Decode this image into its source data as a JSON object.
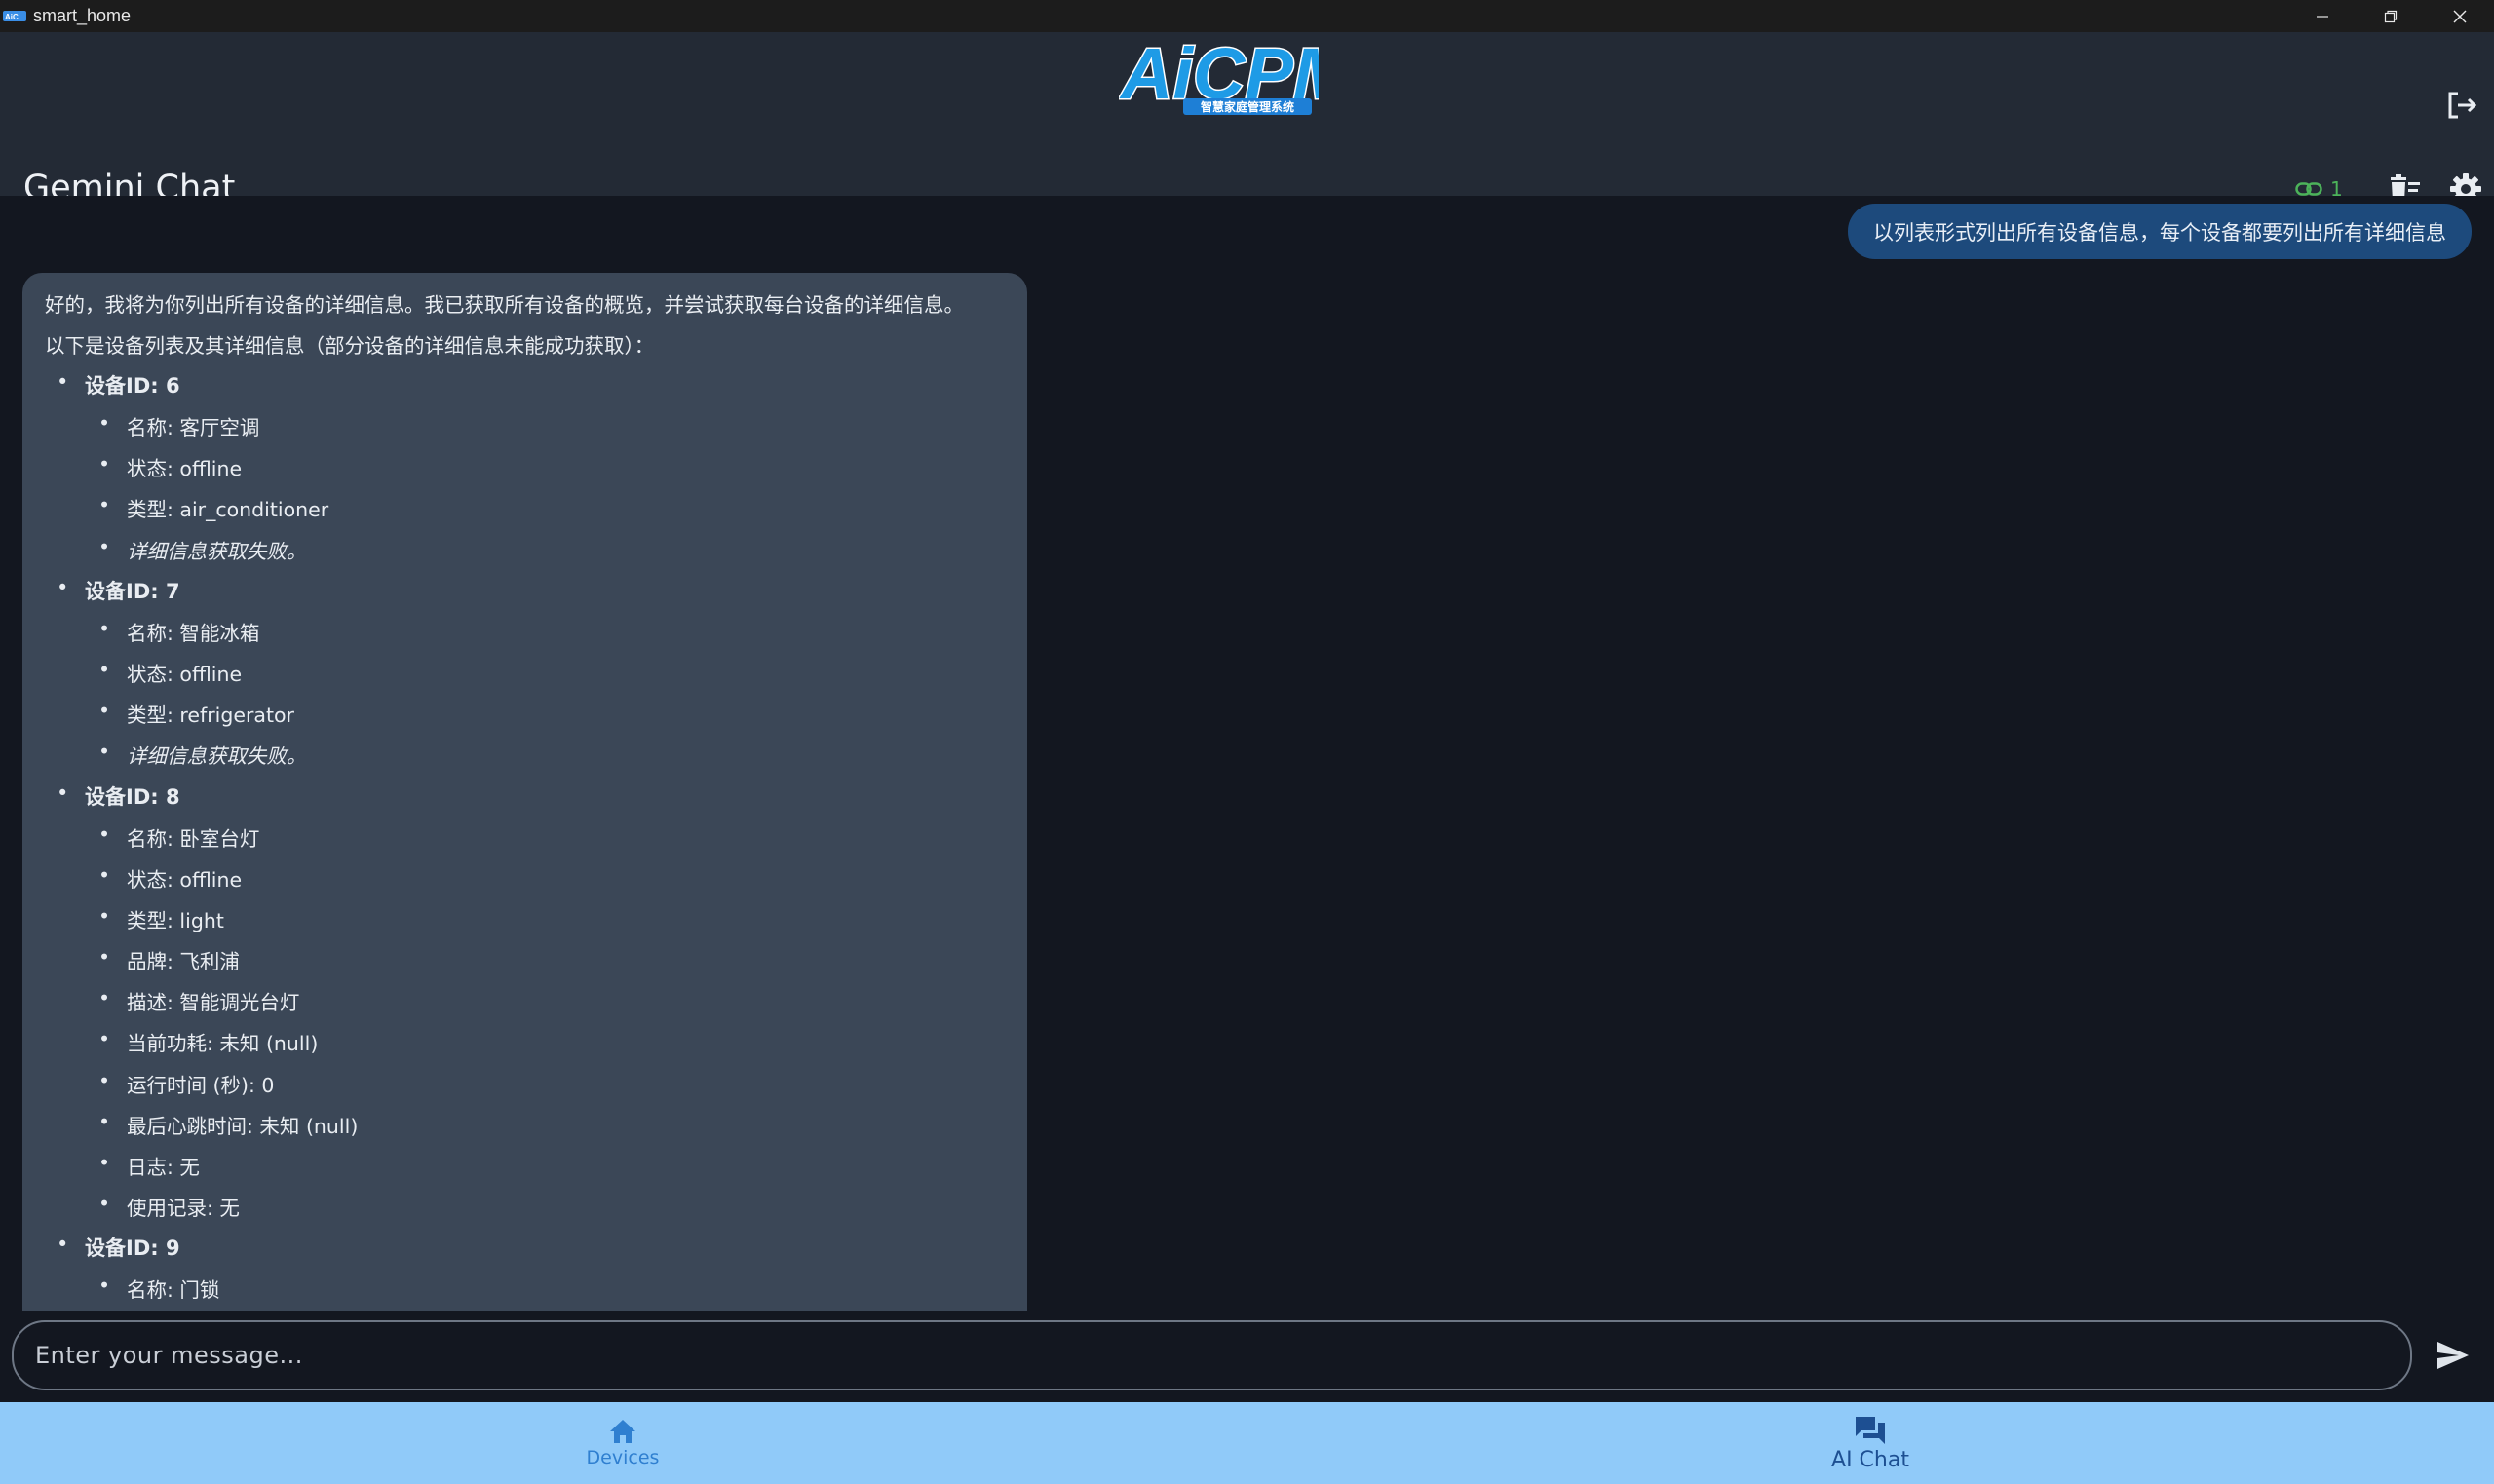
{
  "window": {
    "title": "smart_home",
    "controls": [
      "minimize-icon",
      "restore-icon",
      "close-icon"
    ]
  },
  "header": {
    "logo_text": "AiCPM",
    "logo_subtitle": "智慧家庭管理系统",
    "page_title": "Gemini Chat",
    "connections_count": "1",
    "icons": [
      "logout-icon",
      "link-icon",
      "clear-chat-icon",
      "settings-icon"
    ]
  },
  "colors": {
    "background": "#131720",
    "header": "#232a35",
    "user_bubble": "#1d4a7c",
    "ai_bubble": "#3b4757",
    "connected_green": "#4cb35a",
    "nav_bg": "#90caf9",
    "nav_active": "#2f7fd0"
  },
  "chat": {
    "user_message": "以列表形式列出所有设备信息，每个设备都要列出所有详细信息",
    "ai_intro_1": "好的，我将为你列出所有设备的详细信息。我已获取所有设备的概览，并尝试获取每台设备的详细信息。",
    "ai_intro_2": "以下是设备列表及其详细信息（部分设备的详细信息未能成功获取）：",
    "devices": [
      {
        "header": "设备ID: 6",
        "items": [
          {
            "text": "名称: 客厅空调"
          },
          {
            "text": "状态: offline"
          },
          {
            "text": "类型: air_conditioner"
          },
          {
            "text": "详细信息获取失败。",
            "italic": true
          }
        ]
      },
      {
        "header": "设备ID: 7",
        "items": [
          {
            "text": "名称: 智能冰箱"
          },
          {
            "text": "状态: offline"
          },
          {
            "text": "类型: refrigerator"
          },
          {
            "text": "详细信息获取失败。",
            "italic": true
          }
        ]
      },
      {
        "header": "设备ID: 8",
        "items": [
          {
            "text": "名称: 卧室台灯"
          },
          {
            "text": "状态: offline"
          },
          {
            "text": "类型: light"
          },
          {
            "text": "品牌: 飞利浦"
          },
          {
            "text": "描述: 智能调光台灯"
          },
          {
            "text": "当前功耗: 未知 (null)"
          },
          {
            "text": "运行时间 (秒): 0"
          },
          {
            "text": "最后心跳时间: 未知 (null)"
          },
          {
            "text": "日志: 无"
          },
          {
            "text": "使用记录: 无"
          }
        ]
      },
      {
        "header": "设备ID: 9",
        "items": [
          {
            "text": "名称: 门锁"
          }
        ]
      }
    ]
  },
  "input": {
    "placeholder": "Enter your message...",
    "value": "",
    "send_icon": "send-icon"
  },
  "bottom_nav": {
    "items": [
      {
        "label": "Devices",
        "icon": "home-icon",
        "active": true
      },
      {
        "label": "AI Chat",
        "icon": "chat-icon",
        "active": false
      }
    ]
  }
}
